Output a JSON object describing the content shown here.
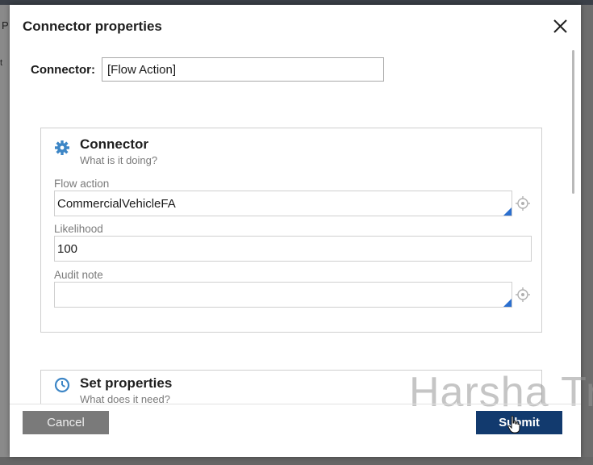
{
  "background": {
    "left_text_1": "P",
    "left_text_2": "t"
  },
  "dialog": {
    "title": "Connector properties",
    "close_icon": "close-icon",
    "connector_label": "Connector:",
    "connector_value": "[Flow Action]"
  },
  "connector_section": {
    "icon": "gear-icon",
    "title": "Connector",
    "subtitle": "What is it doing?",
    "flow_action_label": "Flow action",
    "flow_action_value": "CommercialVehicleFA",
    "likelihood_label": "Likelihood",
    "likelihood_value": "100",
    "audit_note_label": "Audit note",
    "audit_note_value": ""
  },
  "set_properties_section": {
    "icon": "clock-icon",
    "title": "Set properties",
    "subtitle": "What does it need?"
  },
  "watermark": "Harsha Tr",
  "footer": {
    "cancel_label": "Cancel",
    "submit_label": "Submit"
  },
  "colors": {
    "accent": "#2a6fcf",
    "submit_bg": "#123a6e",
    "cancel_bg": "#7a7a7a"
  }
}
